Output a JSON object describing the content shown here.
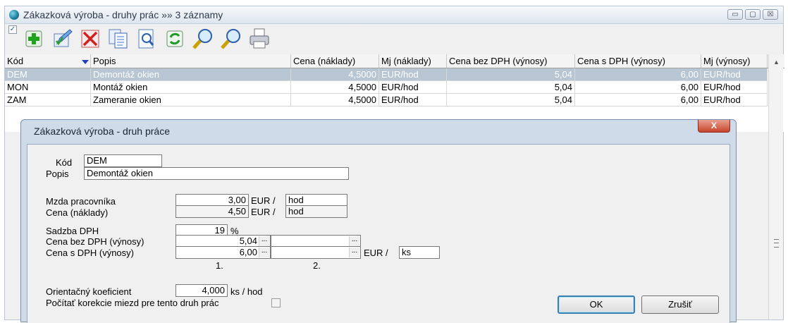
{
  "window": {
    "title": "Zákazková výroba - druhy prác »» 3 záznamy",
    "controls": {
      "minimize": "▭",
      "maximize": "▢",
      "close": "☒"
    }
  },
  "toolbar": {
    "checkbox": "✓",
    "buttons": [
      "add-icon",
      "edit-icon",
      "delete-icon",
      "copy-icon",
      "preview-icon",
      "refresh-icon",
      "search-icon",
      "search-next-icon",
      "print-icon"
    ]
  },
  "grid": {
    "columns": [
      "Kód",
      "Popis",
      "Cena (náklady)",
      "Mj (náklady)",
      "Cena bez DPH (výnosy)",
      "Cena s DPH (výnosy)",
      "Mj (výnosy)"
    ],
    "rows": [
      {
        "kod": "DEM",
        "popis": "Demontáž okien",
        "cena_naklady": "4,5000",
        "mj_naklady": "EUR/hod",
        "cena_bez_dph": "5,04",
        "cena_s_dph": "6,00",
        "mj_vynosy": "EUR/hod"
      },
      {
        "kod": "MON",
        "popis": "Montáž okien",
        "cena_naklady": "4,5000",
        "mj_naklady": "EUR/hod",
        "cena_bez_dph": "5,04",
        "cena_s_dph": "6,00",
        "mj_vynosy": "EUR/hod"
      },
      {
        "kod": "ZAM",
        "popis": "Zameranie okien",
        "cena_naklady": "4,5000",
        "mj_naklady": "EUR/hod",
        "cena_bez_dph": "5,04",
        "cena_s_dph": "6,00",
        "mj_vynosy": "EUR/hod"
      }
    ],
    "selected_row": 0
  },
  "dialog": {
    "title": "Zákazková výroba - druh práce",
    "close": "X",
    "kod_label": "Kód",
    "kod_value": "DEM",
    "popis_label": "Popis",
    "popis_value": "Demontáž okien",
    "mzda_label": "Mzda pracovníka",
    "mzda_value": "3,00",
    "mzda_unit": "EUR /",
    "mzda_mj": "hod",
    "cena_label": "Cena (náklady)",
    "cena_value": "4,50",
    "cena_unit": "EUR /",
    "cena_mj": "hod",
    "dph_label": "Sadzba DPH",
    "dph_value": "19",
    "dph_unit": "%",
    "bez_dph_label": "Cena bez DPH (výnosy)",
    "bez_dph_value": "5,04",
    "bez_dph_value2": "",
    "s_dph_label": "Cena s DPH (výnosy)",
    "s_dph_value": "6,00",
    "s_dph_value2": "",
    "vynosy_unit": "EUR /",
    "vynosy_mj": "ks",
    "ellipsis": "...",
    "col1": "1.",
    "col2": "2.",
    "koef_label": "Orientačný koeficient",
    "koef_value": "4,000",
    "koef_unit": "ks / hod",
    "korekcie_label": "Počítať korekcie miezd pre tento druh prác",
    "ok": "OK",
    "cancel": "Zrušiť"
  }
}
